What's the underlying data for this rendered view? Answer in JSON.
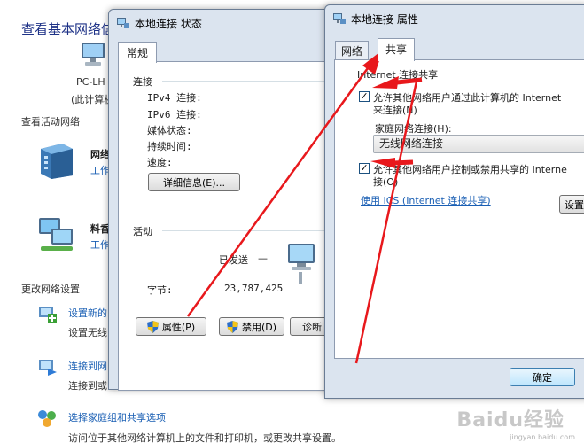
{
  "background": {
    "title": "查看基本网络信",
    "pc_name": "PC-LH",
    "pc_sub": "(此计算机",
    "active_networks_label": "查看活动网络",
    "network1": {
      "name": "网络",
      "type": "工作"
    },
    "network2": {
      "name": "料香",
      "type": "工作"
    },
    "change_settings_label": "更改网络设置",
    "tasks": [
      {
        "link": "设置新的",
        "desc": "设置无线"
      },
      {
        "link": "连接到网",
        "desc": "连接到或"
      },
      {
        "link": "选择家庭组和共享选项",
        "desc": "访问位于其他网络计算机上的文件和打印机，或更改共享设置。"
      }
    ]
  },
  "status_window": {
    "title": "本地连接 状态",
    "tab": "常规",
    "connection_group": "连接",
    "rows": [
      {
        "label": "IPv4 连接:"
      },
      {
        "label": "IPv6 连接:"
      },
      {
        "label": "媒体状态:"
      },
      {
        "label": "持续时间:"
      },
      {
        "label": "速度:"
      }
    ],
    "details_button": "详细信息(E)...",
    "activity_group": "活动",
    "sent_label": "已发送",
    "sent_dash": "—",
    "bytes_label": "字节:",
    "bytes_value": "23,787,425",
    "properties_button": "属性(P)",
    "disable_button": "禁用(D)",
    "diagnose_button": "诊断"
  },
  "properties_window": {
    "title": "本地连接 属性",
    "tabs": [
      "网络",
      "共享"
    ],
    "active_tab": "共享",
    "ics_group": "Internet 连接共享",
    "allow_connect_line1": "允许其他网络用户通过此计算机的 Internet",
    "allow_connect_line2": "来连接(N)",
    "allow_connect_checked": true,
    "home_network_label": "家庭网络连接(H):",
    "home_network_value": "无线网络连接",
    "allow_control_line1": "允许其他网络用户控制或禁用共享的 Interne",
    "allow_control_line2": "接(O)",
    "allow_control_checked": true,
    "ics_link": "使用 ICS (Internet 连接共享)",
    "settings_button": "设置",
    "ok_button": "确定"
  },
  "watermark": {
    "text": "Baidu经验",
    "sub": "jingyan.baidu.com"
  },
  "colors": {
    "annotation_red": "#e8181c",
    "window_frame": "#dbe4ef",
    "link_blue": "#1a5fb4"
  }
}
